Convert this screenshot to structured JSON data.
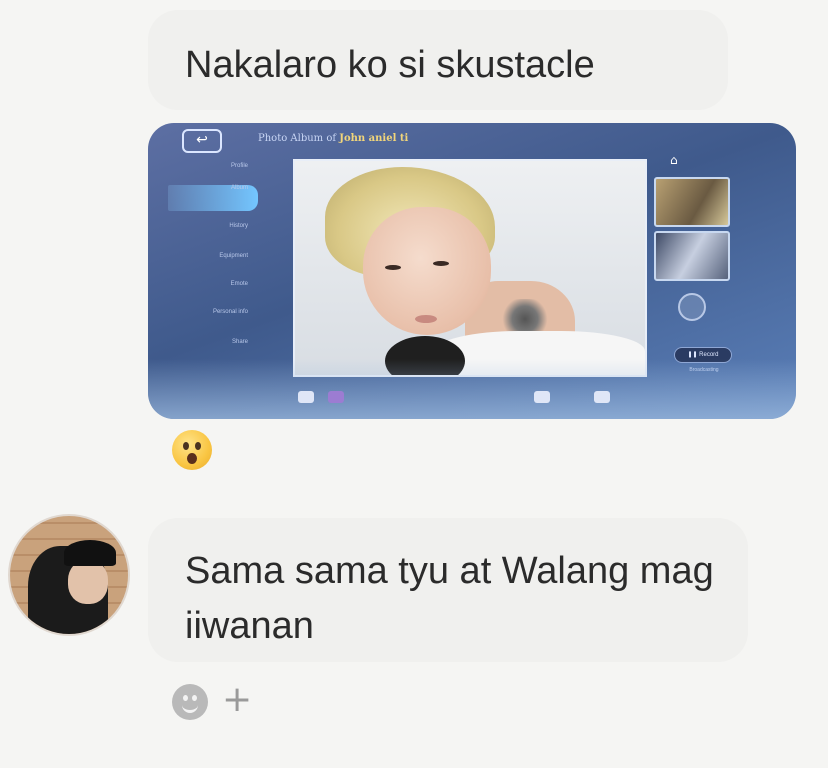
{
  "messages": [
    {
      "id": "msg1",
      "text": "Nakalaro ko si skustacle"
    },
    {
      "id": "msg2",
      "text": "Sama sama tyu at Walang mag iiwanan"
    }
  ],
  "game_screenshot": {
    "back_icon": "back-arrow-icon",
    "title_prefix": "Photo Album of",
    "title_name": "John aniel ti",
    "menu_items": [
      "Profile",
      "Album",
      "History",
      "Equipment",
      "Emote",
      "Personal info",
      "Share"
    ],
    "active_menu_index": 1,
    "home_icon": "home-icon",
    "home_glyph": "⌂",
    "back_glyph": "↩",
    "pill_label": "❚❚ Record",
    "side_caption": "Broadcasting"
  },
  "reaction": {
    "emoji": "surprised-face-icon"
  },
  "composer": {
    "add_glyph": "+"
  },
  "colors": {
    "page_bg": "#f5f5f3",
    "bubble_bg": "#f0f0ee",
    "text": "#2b2b2b",
    "card_bg": "#3f5a8c"
  }
}
